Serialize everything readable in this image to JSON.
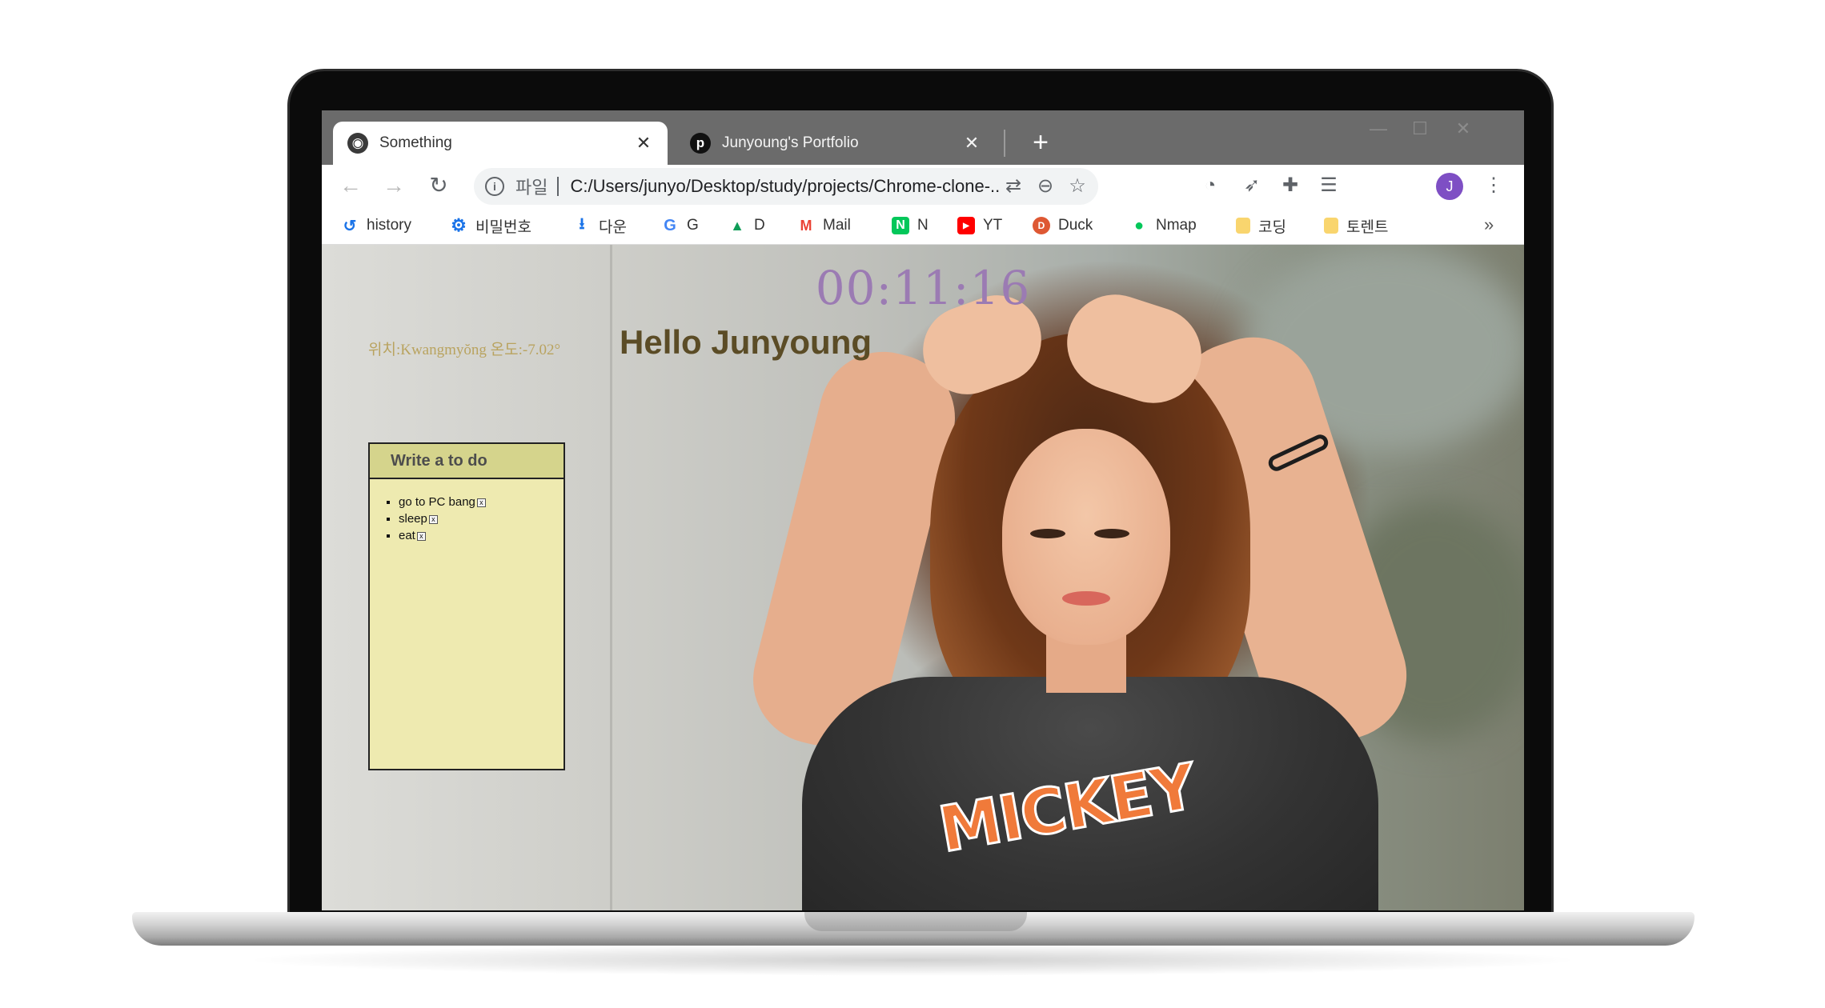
{
  "tabs": [
    {
      "title": "Something",
      "favicon": "globe-icon"
    },
    {
      "title": "Junyoung's Portfolio",
      "favicon": "pinterest-icon"
    }
  ],
  "omnibox": {
    "scheme_label": "파일",
    "url": "C:/Users/junyo/Desktop/study/projects/Chrome-clone-..."
  },
  "bookmarks": [
    {
      "label": "history",
      "icon": "history-icon",
      "color": "#1a73e8"
    },
    {
      "label": "비밀번호",
      "icon": "gear-icon",
      "color": "#1a73e8"
    },
    {
      "label": "다운",
      "icon": "download-icon",
      "color": "#1a73e8"
    },
    {
      "label": "G",
      "icon": "google-icon",
      "color": "#4285f4"
    },
    {
      "label": "D",
      "icon": "drive-icon",
      "color": "#0f9d58"
    },
    {
      "label": "Mail",
      "icon": "gmail-icon",
      "color": "#ea4335"
    },
    {
      "label": "N",
      "icon": "naver-icon",
      "color": "#03c75a"
    },
    {
      "label": "YT",
      "icon": "youtube-icon",
      "color": "#ff0000"
    },
    {
      "label": "Duck",
      "icon": "duckduckgo-icon",
      "color": "#de5833"
    },
    {
      "label": "Nmap",
      "icon": "naver-map-icon",
      "color": "#03c75a"
    },
    {
      "label": "코딩",
      "icon": "folder-icon",
      "color": "#f9d56e"
    },
    {
      "label": "토렌트",
      "icon": "folder-icon",
      "color": "#f9d56e"
    }
  ],
  "profile_initial": "J",
  "page": {
    "clock": "00:11:16",
    "weather": "위치:Kwangmyŏng 온도:-7.02°",
    "greeting": "Hello Junyoung",
    "todo_placeholder": "Write a to do",
    "todos": [
      "go to PC bang",
      "sleep",
      "eat"
    ],
    "todo_delete_glyph": "x"
  },
  "colors": {
    "clock": "#9b7bb3",
    "greeting": "#5b4c26",
    "todo_bg": "#eeeab0",
    "todo_header": "#d5d48c",
    "avatar": "#7e4fc4"
  }
}
